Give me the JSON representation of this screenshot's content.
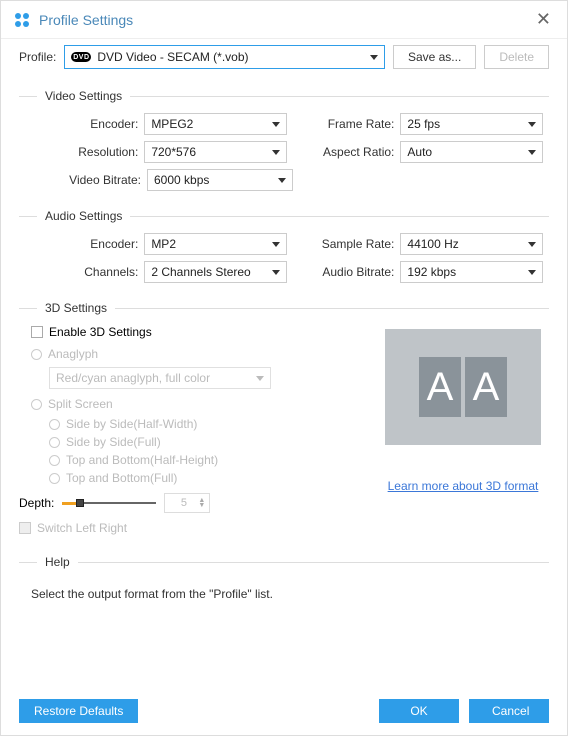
{
  "window": {
    "title": "Profile Settings"
  },
  "profile": {
    "label": "Profile:",
    "selected": "DVD Video - SECAM (*.vob)",
    "save_as": "Save as...",
    "delete": "Delete"
  },
  "video": {
    "section": "Video Settings",
    "encoder_label": "Encoder:",
    "encoder": "MPEG2",
    "frame_rate_label": "Frame Rate:",
    "frame_rate": "25 fps",
    "resolution_label": "Resolution:",
    "resolution": "720*576",
    "aspect_ratio_label": "Aspect Ratio:",
    "aspect_ratio": "Auto",
    "bitrate_label": "Video Bitrate:",
    "bitrate": "6000 kbps"
  },
  "audio": {
    "section": "Audio Settings",
    "encoder_label": "Encoder:",
    "encoder": "MP2",
    "sample_rate_label": "Sample Rate:",
    "sample_rate": "44100 Hz",
    "channels_label": "Channels:",
    "channels": "2 Channels Stereo",
    "bitrate_label": "Audio Bitrate:",
    "bitrate": "192 kbps"
  },
  "three_d": {
    "section": "3D Settings",
    "enable": "Enable 3D Settings",
    "anaglyph": "Anaglyph",
    "anaglyph_mode": "Red/cyan anaglyph, full color",
    "split_screen": "Split Screen",
    "sbs_half": "Side by Side(Half-Width)",
    "sbs_full": "Side by Side(Full)",
    "tab_half": "Top and Bottom(Half-Height)",
    "tab_full": "Top and Bottom(Full)",
    "depth_label": "Depth:",
    "depth_value": "5",
    "switch_lr": "Switch Left Right",
    "preview_a": "A",
    "preview_b": "A",
    "learn_more": "Learn more about 3D format"
  },
  "help": {
    "section": "Help",
    "text": "Select the output format from the \"Profile\" list."
  },
  "footer": {
    "restore": "Restore Defaults",
    "ok": "OK",
    "cancel": "Cancel"
  }
}
